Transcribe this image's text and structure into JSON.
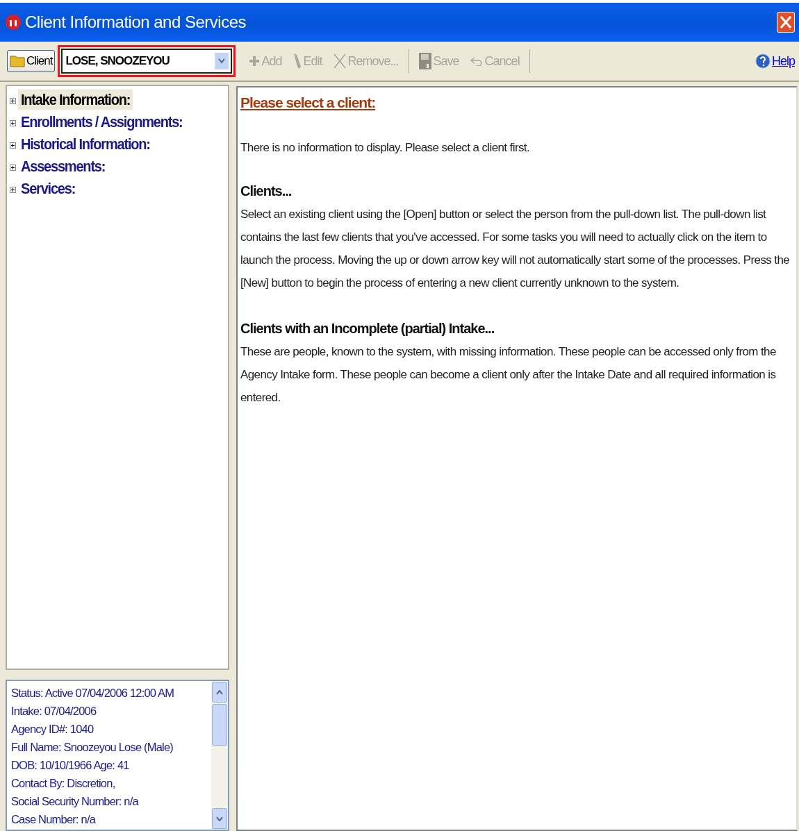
{
  "window": {
    "title": "Client Information and Services"
  },
  "toolbar": {
    "client_button": "Client",
    "client_combo": {
      "value": "LOSE, SNOOZEYOU",
      "highlighted": true
    },
    "buttons": [
      {
        "kind": "add",
        "label": "Add",
        "disabled": true
      },
      {
        "kind": "edit",
        "label": "Edit",
        "disabled": true
      },
      {
        "kind": "remove",
        "label": "Remove...",
        "disabled": true
      },
      {
        "kind": "save",
        "label": "Save",
        "disabled": true
      },
      {
        "kind": "cancel",
        "label": "Cancel",
        "disabled": true
      }
    ],
    "help": "Help"
  },
  "tree": {
    "items": [
      {
        "label": "Intake Information:",
        "selected": true,
        "expanded": false
      },
      {
        "label": "Enrollments / Assignments:",
        "selected": false,
        "expanded": false
      },
      {
        "label": "Historical Information:",
        "selected": false,
        "expanded": false
      },
      {
        "label": "Assessments:",
        "selected": false,
        "expanded": false
      },
      {
        "label": "Services:",
        "selected": false,
        "expanded": false
      }
    ]
  },
  "client_summary": {
    "lines": [
      "Status: Active 07/04/2006 12:00 AM",
      "Intake: 07/04/2006",
      "Agency ID#: 1040",
      "Full Name: Snoozeyou Lose  (Male)",
      "DOB: 10/10/1966  Age: 41",
      "Contact By: Discretion,",
      "Social Security Number: n/a",
      "Case Number: n/a"
    ]
  },
  "content": {
    "heading": "Please select a client:",
    "intro": "There is no information to display.  Please select a client first.",
    "sections": [
      {
        "title": "Clients...",
        "text": "Select an existing client using the [Open] button or select the person from the pull-down list.  The pull-down list contains the last few clients that you've accessed.  For some tasks you will need to actually click on the item to launch the process.  Moving the up or down arrow key will not automatically start some of the processes.  Press the [New] button to begin the process of entering a new client currently unknown to the system."
      },
      {
        "title": "Clients with an Incomplete (partial) Intake...",
        "text": "These are people, known to the system, with missing information.  These people can be accessed only from the Agency Intake form.  These people can become a client only after the Intake Date and all required information is entered."
      }
    ]
  }
}
